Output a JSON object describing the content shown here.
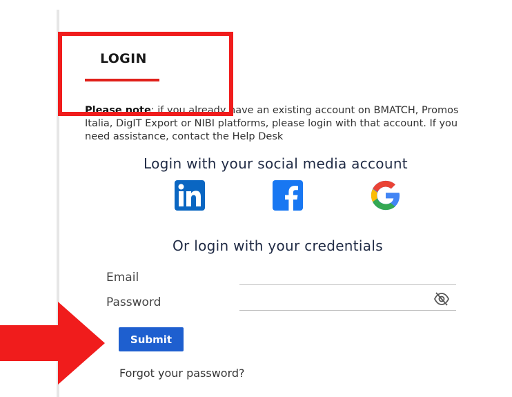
{
  "login": {
    "title": "LOGIN",
    "note_bold": "Please note",
    "note_text": ": if you already have an existing account on BMATCH, Promos Italia, DigIT Export or NIBI platforms, please login with that account. If you need assistance, contact the Help Desk"
  },
  "social": {
    "heading": "Login with your social media account",
    "icons": [
      "linkedin-icon",
      "facebook-icon",
      "google-icon"
    ],
    "colors": {
      "linkedin": "#0a66c2",
      "facebook": "#1877f2"
    }
  },
  "credentials": {
    "heading": "Or login with your credentials",
    "email_label": "Email",
    "email_value": "",
    "password_label": "Password",
    "password_value": ""
  },
  "actions": {
    "submit_label": "Submit",
    "forgot_label": "Forgot your password?"
  },
  "annotations": {
    "highlight_color": "#f01c1c",
    "arrow_color": "#f01c1c"
  }
}
